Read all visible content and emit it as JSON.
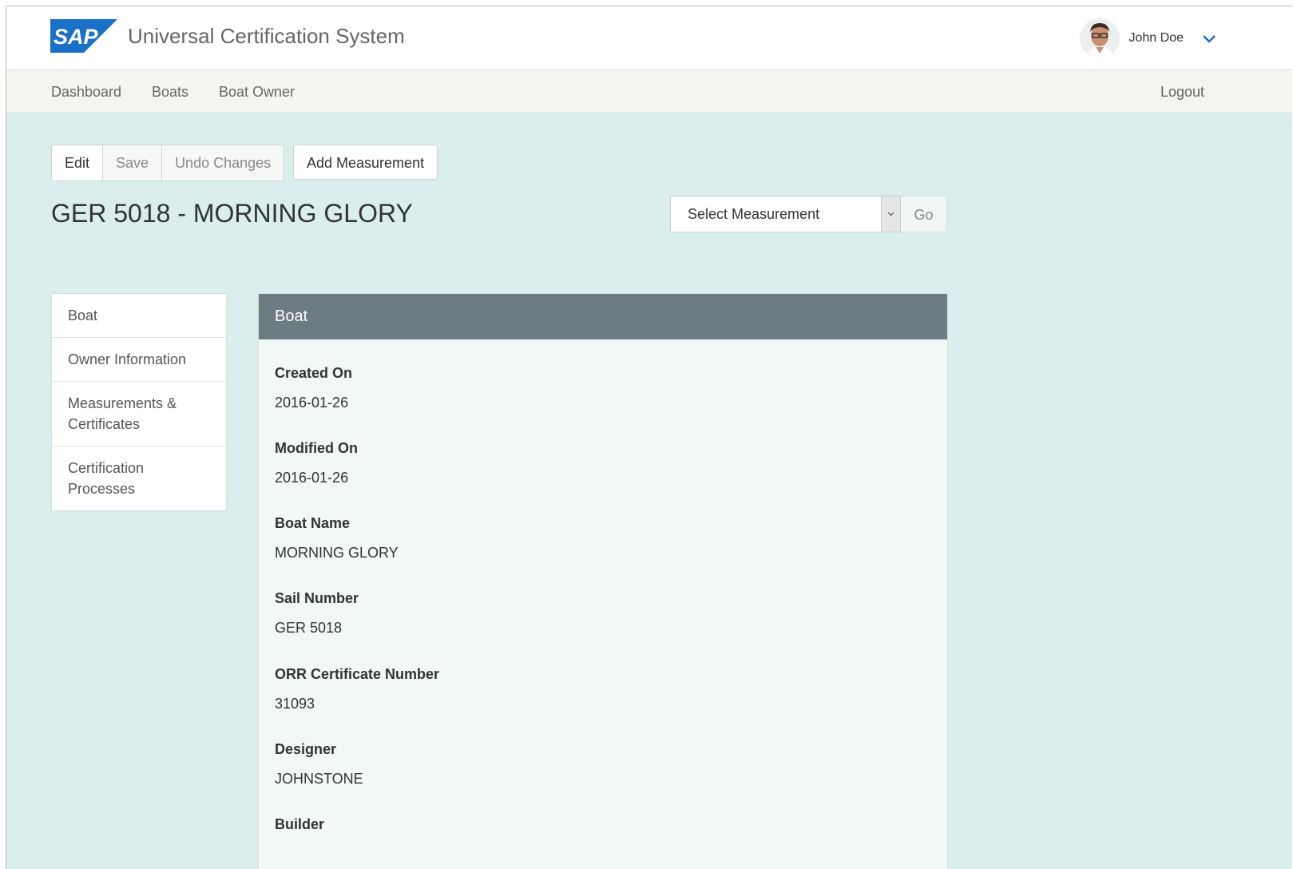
{
  "brand": {
    "logo_text": "SAP",
    "logo_color": "#1a6fc6"
  },
  "header": {
    "app_title": "Universal Certification System"
  },
  "user": {
    "name": "John Doe"
  },
  "nav": {
    "items": [
      "Dashboard",
      "Boats",
      "Boat Owner"
    ],
    "logout": "Logout"
  },
  "toolbar": {
    "edit": "Edit",
    "save": "Save",
    "undo": "Undo Changes",
    "add_measurement": "Add Measurement"
  },
  "page": {
    "title": "GER 5018 - MORNING GLORY"
  },
  "measurement_select": {
    "selected": "Select Measurement",
    "go": "Go"
  },
  "sidebar": {
    "items": [
      {
        "label": "Boat"
      },
      {
        "label": "Owner Information"
      },
      {
        "label": "Measurements & Certificates"
      },
      {
        "label": "Certification Processes"
      }
    ]
  },
  "panel": {
    "title": "Boat",
    "fields": [
      {
        "label": "Created On",
        "value": "2016-01-26"
      },
      {
        "label": "Modified On",
        "value": "2016-01-26"
      },
      {
        "label": "Boat Name",
        "value": "MORNING GLORY"
      },
      {
        "label": "Sail Number",
        "value": "GER 5018"
      },
      {
        "label": "ORR Certificate Number",
        "value": "31093"
      },
      {
        "label": "Designer",
        "value": "JOHNSTONE"
      },
      {
        "label": "Builder",
        "value": ""
      }
    ]
  },
  "colors": {
    "page_background": "#dbeeee",
    "panel_header": "#6d7b82",
    "accent": "#1a6fc6"
  }
}
